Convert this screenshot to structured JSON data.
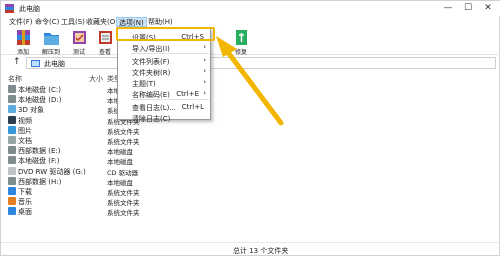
{
  "window": {
    "title": "此电脑",
    "minimize": "—",
    "maximize": "☐",
    "close": "✕"
  },
  "menubar": {
    "items": [
      "文件(F)",
      "命令(C)",
      "工具(S)",
      "收藏夹(O)",
      "选项(N)",
      "帮助(H)"
    ],
    "active_index": 4
  },
  "toolbar": {
    "buttons": [
      "添加",
      "解压到",
      "测试",
      "查看",
      "",
      "",
      "",
      "修复"
    ]
  },
  "address": {
    "up": "↑",
    "path": "此电脑"
  },
  "columns": {
    "name": "名称",
    "size": "大小",
    "type": "类型"
  },
  "files": [
    {
      "name": "本地磁盘 (C:)",
      "type": "本地磁盘",
      "icon": "drive-icon"
    },
    {
      "name": "本地磁盘 (D:)",
      "type": "本地磁盘",
      "icon": "drive-icon"
    },
    {
      "name": "3D 对象",
      "type": "系统文件夹",
      "icon": "folder-3d-icon"
    },
    {
      "name": "视频",
      "type": "系统文件夹",
      "icon": "video-icon"
    },
    {
      "name": "图片",
      "type": "系统文件夹",
      "icon": "picture-icon"
    },
    {
      "name": "文档",
      "type": "系统文件夹",
      "icon": "document-icon"
    },
    {
      "name": "西部数据 (E:)",
      "type": "本地磁盘",
      "icon": "drive-icon"
    },
    {
      "name": "本地磁盘 (F:)",
      "type": "本地磁盘",
      "icon": "drive-icon"
    },
    {
      "name": "DVD RW 驱动器 (G:)",
      "type": "CD 驱动器",
      "icon": "dvd-icon"
    },
    {
      "name": "西部数据 (H:)",
      "type": "本地磁盘",
      "icon": "drive-icon"
    },
    {
      "name": "下载",
      "type": "系统文件夹",
      "icon": "download-icon"
    },
    {
      "name": "音乐",
      "type": "系统文件夹",
      "icon": "music-icon"
    },
    {
      "name": "桌面",
      "type": "系统文件夹",
      "icon": "desktop-icon"
    }
  ],
  "status": {
    "count": "总计 13 个文件夹"
  },
  "dropdown": {
    "items": [
      {
        "label": "设置(S)...",
        "shortcut": "Ctrl+S",
        "submenu": false
      },
      {
        "label": "导入/导出(I)",
        "shortcut": "",
        "submenu": true
      },
      {
        "label": "文件列表(F)",
        "shortcut": "",
        "submenu": true
      },
      {
        "label": "文件夹树(R)",
        "shortcut": "",
        "submenu": true
      },
      {
        "label": "主题(T)",
        "shortcut": "",
        "submenu": true
      },
      {
        "label": "名称编码(E)",
        "shortcut": "Ctrl+E",
        "submenu": true
      },
      {
        "label": "查看日志(L)...",
        "shortcut": "Ctrl+L",
        "submenu": false
      },
      {
        "label": "清除日志(C)",
        "shortcut": "",
        "submenu": false
      }
    ]
  },
  "colors": {
    "highlight": "#f2b500",
    "menu_active": "#cce4f7",
    "accent": "#3a7bd5"
  }
}
